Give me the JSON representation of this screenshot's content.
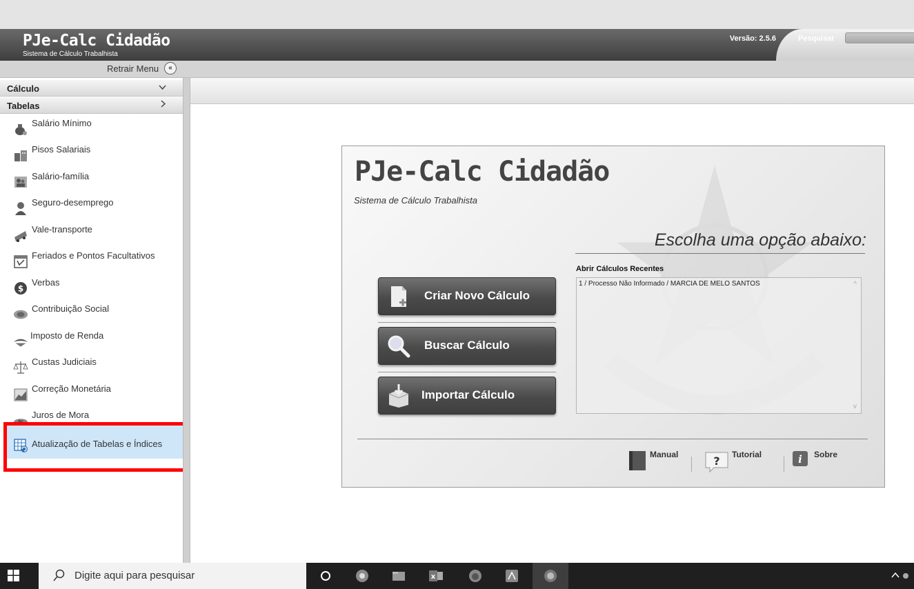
{
  "header": {
    "title": "PJe-Calc Cidadão",
    "subtitle": "Sistema de Cálculo Trabalhista",
    "version": "Versão: 2.5.6",
    "search_label": "Pesquisar"
  },
  "menu_toggle": {
    "label": "Retrair Menu"
  },
  "sidebar": {
    "sections": [
      {
        "label": "Cálculo",
        "chevron": "chevron-down"
      },
      {
        "label": "Tabelas",
        "chevron": "chevron-right"
      }
    ],
    "items": [
      {
        "label": "Salário Mínimo",
        "icon": "money-bag-icon"
      },
      {
        "label": "Pisos Salariais",
        "icon": "building-icon"
      },
      {
        "label": "Salário-família",
        "icon": "family-icon"
      },
      {
        "label": "Seguro-desemprego",
        "icon": "person-icon"
      },
      {
        "label": "Vale-transporte",
        "icon": "bus-icon"
      },
      {
        "label": "Feriados e Pontos Facultativos",
        "icon": "calendar-icon"
      },
      {
        "label": "Verbas",
        "icon": "dollar-coin-icon"
      },
      {
        "label": "Contribuição Social",
        "icon": "social-contribution-icon"
      },
      {
        "label": "Imposto de Renda",
        "icon": "income-tax-icon"
      },
      {
        "label": "Custas Judiciais",
        "icon": "scales-icon"
      },
      {
        "label": "Correção Monetária",
        "icon": "chart-icon"
      },
      {
        "label": "Juros de Mora",
        "icon": "percent-icon"
      },
      {
        "label": "Atualização de Tabelas e Índices",
        "icon": "table-refresh-icon"
      }
    ]
  },
  "main": {
    "title": "PJe-Calc Cidadão",
    "subtitle": "Sistema de Cálculo Trabalhista",
    "choose_label": "Escolha uma opção abaixo:",
    "buttons": {
      "new_calc": "Criar Novo Cálculo",
      "search_calc": "Buscar Cálculo",
      "import_calc": "Importar Cálculo"
    },
    "recent": {
      "label": "Abrir Cálculos Recentes",
      "items": [
        "1 / Processo Não Informado / MARCIA DE MELO SANTOS"
      ]
    },
    "footer": {
      "manual": "Manual",
      "tutorial": "Tutorial",
      "about": "Sobre"
    }
  },
  "taskbar": {
    "search_placeholder": "Digite aqui para pesquisar"
  },
  "colors": {
    "header": "#4a4a4a",
    "highlight_border": "#ff0000",
    "selected_item": "#cfe6f9",
    "taskbar": "#1f1f1f"
  }
}
